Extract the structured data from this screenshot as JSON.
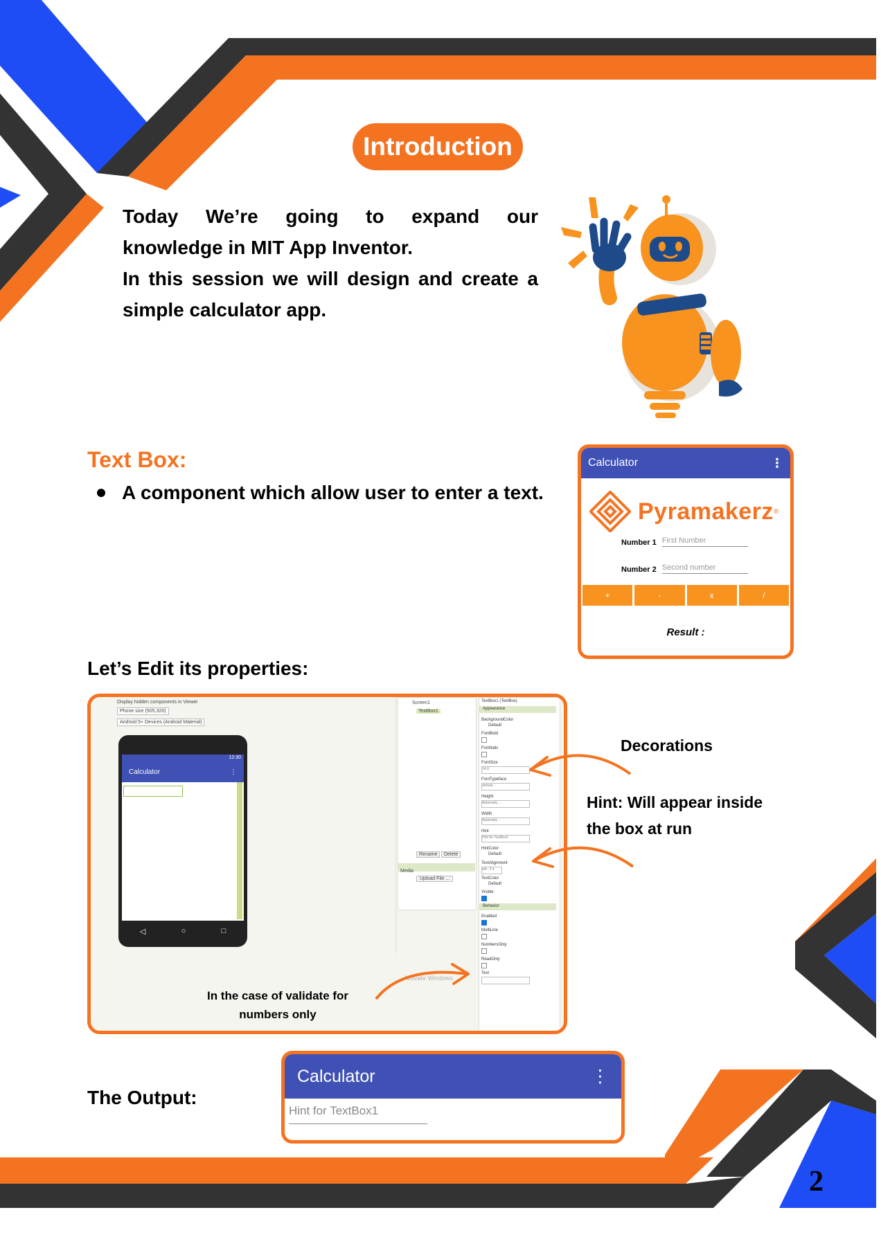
{
  "intro": {
    "heading": "Introduction",
    "line1": "Today We’re going to expand our",
    "line2": "knowledge in MIT App Inventor.",
    "line3": "In this session we will design and create a",
    "line4": "simple calculator app."
  },
  "textbox_section": {
    "heading": "Text Box:",
    "bullet": "A component which allow user to enter a text."
  },
  "calc_preview": {
    "title": "Calculator",
    "brand": "Pyramakerz",
    "label1": "Number 1",
    "hint1": "First Number",
    "label2": "Number 2",
    "hint2": "Second number",
    "buttons": [
      "+",
      "-",
      "x",
      "/"
    ],
    "result": "Result :"
  },
  "edit_section": {
    "heading": "Let’s Edit its properties:"
  },
  "designer": {
    "viewer_checkbox": "Display hidden components in Viewer",
    "phone_size": "Phone size (505,320)",
    "device": "Android 5+ Devices (Android Material)",
    "status_time": "12:30",
    "app_title": "Calculator",
    "tree_screen": "Screen1",
    "tree_textbox": "TextBox1",
    "rename": "Rename",
    "delete": "Delete",
    "media": "Media",
    "upload": "Upload File ...",
    "props_title": "TextBox1 (TextBox)",
    "appearance": "Appearance",
    "behavior": "Behavior",
    "p_bgcolor": "BackgroundColor",
    "v_bgcolor": "Default",
    "p_fontbold": "FontBold",
    "p_fontitalic": "FontItalic",
    "p_fontsize": "FontSize",
    "v_fontsize": "14.0",
    "p_typeface": "FontTypeface",
    "v_typeface": "default...",
    "p_height": "Height",
    "v_height": "Automatic...",
    "p_width": "Width",
    "v_width": "Automatic...",
    "p_hint": "Hint",
    "v_hint": "Hint for TextBox1",
    "p_hintcolor": "HintColor",
    "v_hintcolor": "Default",
    "p_textalign": "TextAlignment",
    "v_textalign": "left : 0 ▾",
    "p_textcolor": "TextColor",
    "v_textcolor": "Default",
    "p_visible": "Visible",
    "p_enabled": "Enabled",
    "p_multiline": "MultiLine",
    "p_numbersonly": "NumbersOnly",
    "p_readonly": "ReadOnly",
    "p_text": "Text",
    "watermark": "Activate Windows"
  },
  "annotations": {
    "decorations": "Decorations",
    "hint_line1": "Hint: Will appear inside",
    "hint_line2": "the box at run",
    "numbers_line1": "In the case of validate for",
    "numbers_line2": "numbers only"
  },
  "output": {
    "label": "The Output:",
    "title": "Calculator",
    "hint": "Hint for TextBox1"
  },
  "page_number": "2",
  "colors": {
    "orange": "#f47321",
    "blue": "#1e4df5",
    "dark": "#333333",
    "appbar": "#3f51b5"
  }
}
